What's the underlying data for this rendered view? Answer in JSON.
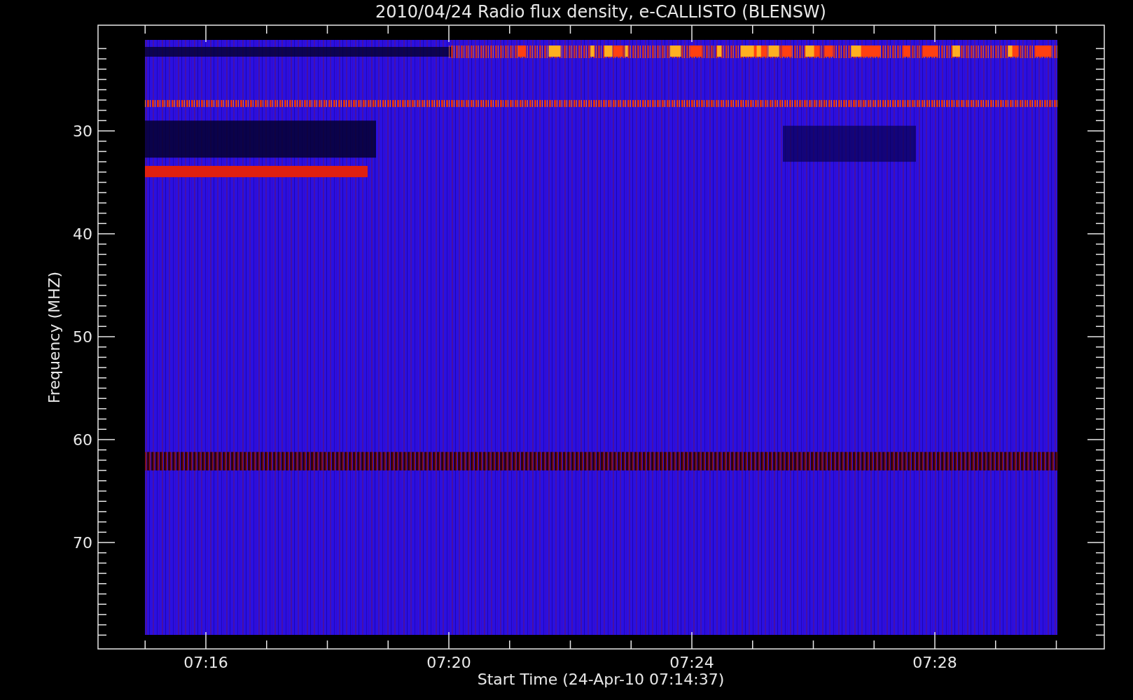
{
  "chart": {
    "title": "2010/04/24  Radio flux density, e-CALLISTO (BLENSW)",
    "ylabel": "Frequency (MHZ)",
    "xlabel": "Start Time (24-Apr-10 07:14:37)",
    "y_ticks": [
      "30",
      "40",
      "50",
      "60",
      "70"
    ],
    "x_ticks": [
      "07:16",
      "07:20",
      "07:24",
      "07:28"
    ]
  }
}
